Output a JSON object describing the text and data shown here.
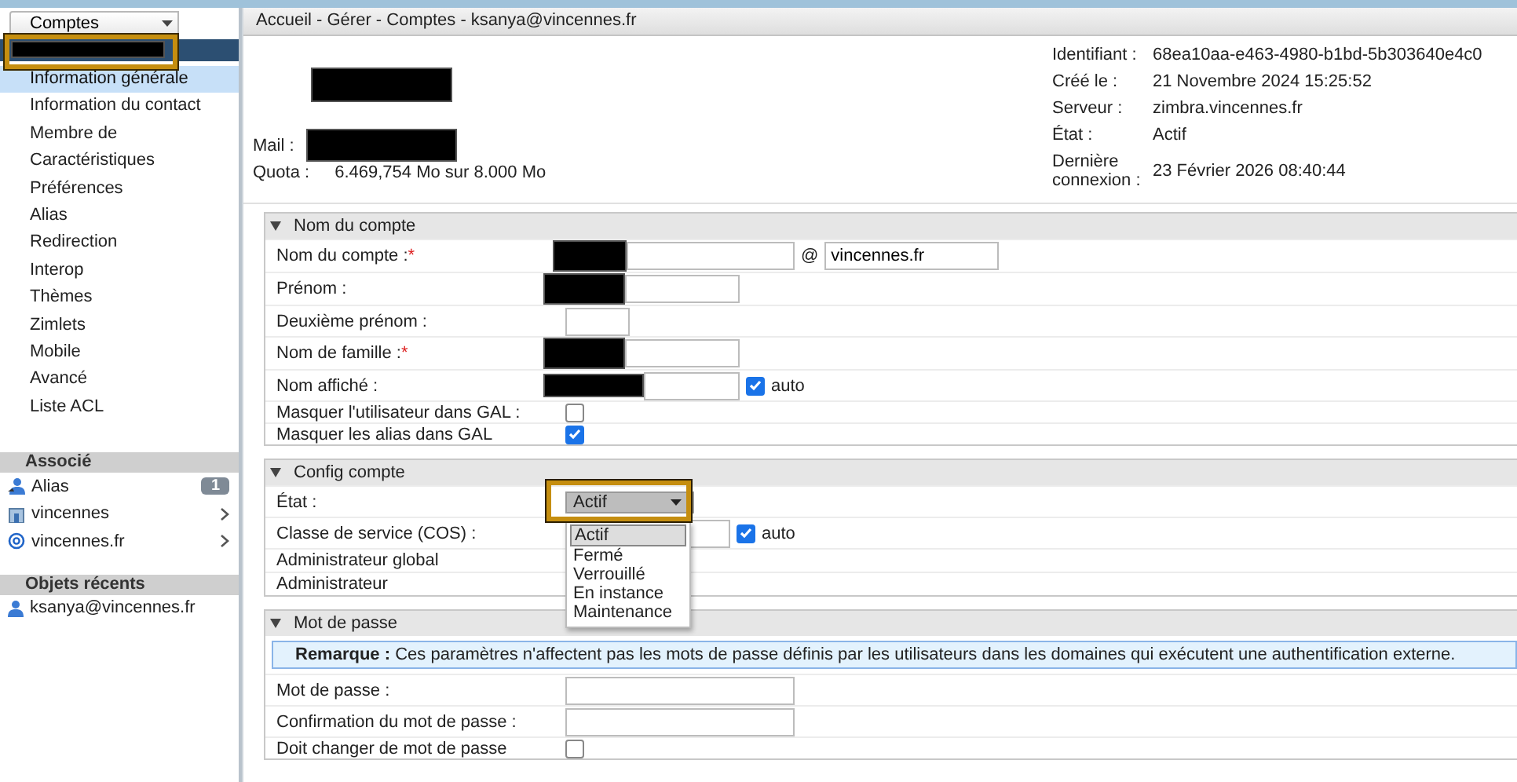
{
  "sidebar": {
    "back_button": "Comptes",
    "account": {
      "redacted": true,
      "highlighted": true
    },
    "nav_items": [
      {
        "label": "Information générale",
        "selected": true
      },
      {
        "label": "Information du contact",
        "selected": false
      },
      {
        "label": "Membre de",
        "selected": false
      },
      {
        "label": "Caractéristiques",
        "selected": false
      },
      {
        "label": "Préférences",
        "selected": false
      },
      {
        "label": "Alias",
        "selected": false
      },
      {
        "label": "Redirection",
        "selected": false
      },
      {
        "label": "Interop",
        "selected": false
      },
      {
        "label": "Thèmes",
        "selected": false
      },
      {
        "label": "Zimlets",
        "selected": false
      },
      {
        "label": "Mobile",
        "selected": false
      },
      {
        "label": "Avancé",
        "selected": false
      },
      {
        "label": "Liste ACL",
        "selected": false
      }
    ],
    "groups": [
      {
        "title": "Associé",
        "items": [
          {
            "kind": "alias",
            "label": "Alias",
            "count": "1",
            "has_children": false
          },
          {
            "kind": "cos",
            "label": "vincennes",
            "has_children": true
          },
          {
            "kind": "domain",
            "label": "vincennes.fr",
            "has_children": true
          }
        ]
      },
      {
        "title": "Objets récents",
        "items": [
          {
            "kind": "account",
            "label": "ksanya@vincennes.fr",
            "has_children": false
          }
        ]
      }
    ]
  },
  "title_bar": "Accueil - Gérer - Comptes - ksanya@vincennes.fr",
  "summary": {
    "name_redacted": true,
    "mail_label": "Mail :",
    "mail_redacted": true,
    "quota_label": "Quota :",
    "quota_value": "6.469,754 Mo sur 8.000 Mo",
    "details": [
      {
        "label": "Identifiant :",
        "value": "68ea10aa-e463-4980-b1bd-5b303640e4c0"
      },
      {
        "label": "Créé le :",
        "value": "21 Novembre 2024 15:25:52"
      },
      {
        "label": "Serveur :",
        "value": "zimbra.vincennes.fr"
      },
      {
        "label": "État :",
        "value": "Actif"
      },
      {
        "label": "Dernière connexion :",
        "value": "23 Février 2026 08:40:44"
      }
    ]
  },
  "sections": [
    {
      "title": "Nom du compte",
      "expanded": true,
      "rows": [
        {
          "kind": "account_name",
          "label": "Nom du compte :",
          "marker": "*",
          "redacted": true,
          "at": "@",
          "domain": "vincennes.fr"
        },
        {
          "kind": "text",
          "label": "Prénom :",
          "redacted": true
        },
        {
          "kind": "short_text",
          "label": "Deuxième prénom :",
          "redacted": false
        },
        {
          "kind": "text",
          "label": "Nom de famille :",
          "marker": "*",
          "redacted": true
        },
        {
          "kind": "text",
          "label": "Nom affiché :",
          "redacted": true,
          "auto": {
            "label": "auto",
            "checked": true
          }
        },
        {
          "kind": "checkbox",
          "label": "Masquer l'utilisateur dans GAL :",
          "checked": false
        },
        {
          "kind": "checkbox",
          "label": "Masquer les alias dans GAL",
          "checked": true
        }
      ]
    },
    {
      "title": "Config compte",
      "expanded": true,
      "rows": [
        {
          "kind": "select",
          "label": "État :",
          "value": "Actif",
          "highlighted": true,
          "open": true,
          "options": [
            {
              "label": "Actif",
              "selected": true
            },
            {
              "label": "Fermé",
              "selected": false
            },
            {
              "label": "Verrouillé",
              "selected": false
            },
            {
              "label": "En instance",
              "selected": false
            },
            {
              "label": "Maintenance",
              "selected": false
            }
          ]
        },
        {
          "kind": "text",
          "label": "Classe de service (COS) :",
          "redacted": false,
          "auto": {
            "label": "auto",
            "checked": true
          }
        },
        {
          "kind": "plain",
          "label": "Administrateur global"
        },
        {
          "kind": "plain",
          "label": "Administrateur"
        }
      ]
    },
    {
      "title": "Mot de passe",
      "expanded": true,
      "note": "**Remarque :** Ces paramètres n'affectent pas les mots de passe définis par les utilisateurs dans les domaines qui exécutent une authentification externe.",
      "rows": [
        {
          "kind": "password",
          "label": "Mot de passe :"
        },
        {
          "kind": "password",
          "label": "Confirmation du mot de passe :"
        },
        {
          "kind": "checkbox",
          "label": "Doit changer de mot de passe",
          "checked": false
        }
      ]
    }
  ]
}
